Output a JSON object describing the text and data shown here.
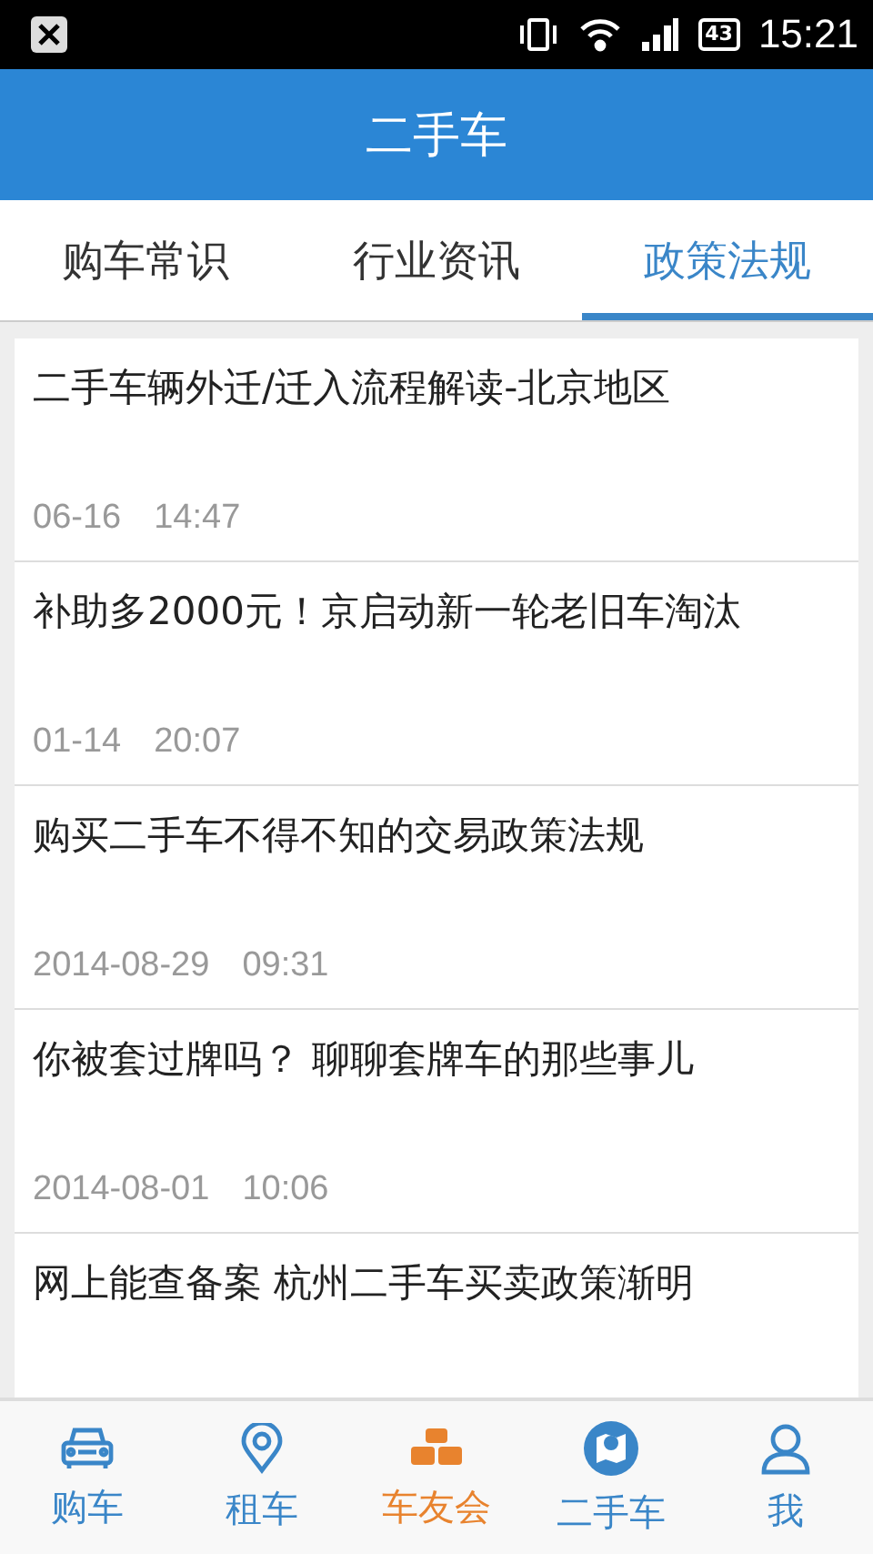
{
  "status_bar": {
    "battery": "43",
    "time": "15:21"
  },
  "header": {
    "title": "二手车"
  },
  "tabs": [
    {
      "label": "购车常识",
      "selected": false
    },
    {
      "label": "行业资讯",
      "selected": false
    },
    {
      "label": "政策法规",
      "selected": true
    }
  ],
  "articles": [
    {
      "title": "二手车辆外迁/迁入流程解读-北京地区",
      "date": "06-16",
      "time": "14:47"
    },
    {
      "title": "补助多2000元！京启动新一轮老旧车淘汰",
      "date": "01-14",
      "time": "20:07"
    },
    {
      "title": "购买二手车不得不知的交易政策法规",
      "date": "2014-08-29",
      "time": "09:31"
    },
    {
      "title": "你被套过牌吗？ 聊聊套牌车的那些事儿",
      "date": "2014-08-01",
      "time": "10:06"
    },
    {
      "title": "网上能查备案 杭州二手车买卖政策渐明"
    }
  ],
  "bottom_nav": [
    {
      "label": "购车",
      "selected": false
    },
    {
      "label": "租车",
      "selected": false
    },
    {
      "label": "车友会",
      "selected": true
    },
    {
      "label": "二手车",
      "selected": false
    },
    {
      "label": "我",
      "selected": false
    }
  ]
}
